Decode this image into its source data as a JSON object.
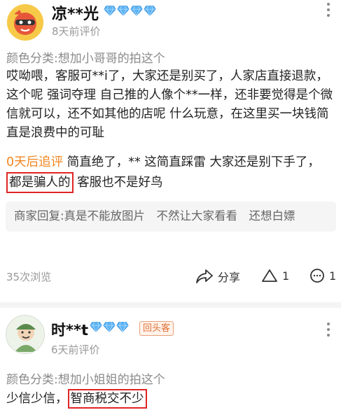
{
  "reviews": [
    {
      "username": "凉**光",
      "time": "8天前评价",
      "sku": "颜色分类:想加小哥哥的拍这个",
      "content": "哎呦喂，客服可**i了，大家还是别买了，人家店直接退款，这个呢 强词夺理 自己推的人像个**一样，还非要觉得是个微信就可以，还不如其他的店呢 什么玩意，在这里买一块钱简直是浪费中的可耻",
      "followup_tag": "0天后追评",
      "followup_pre": " 简直绝了，** 这简直踩雷 大家还是别下手了，",
      "followup_highlight": "都是骗人的",
      "followup_post": " 客服也不是好鸟",
      "reply": "商家回复:真是不能放图片　不然让大家看看　还想白嫖",
      "views": "35次浏览",
      "share_label": "分享",
      "like_count": "1",
      "dislike_count": "1",
      "diamond_count": 4
    },
    {
      "username": "时**t",
      "badge": "回头客",
      "time": "6天前评价",
      "sku": "颜色分类:想加小姐姐的拍这个",
      "content_pre": "少信少信，",
      "content_highlight": "智商税交不少",
      "diamond_count": 3
    }
  ],
  "colors": {
    "followup_tag": "#f0861f",
    "highlight_border": "#e02424",
    "diamond": "#4aa8f0"
  }
}
